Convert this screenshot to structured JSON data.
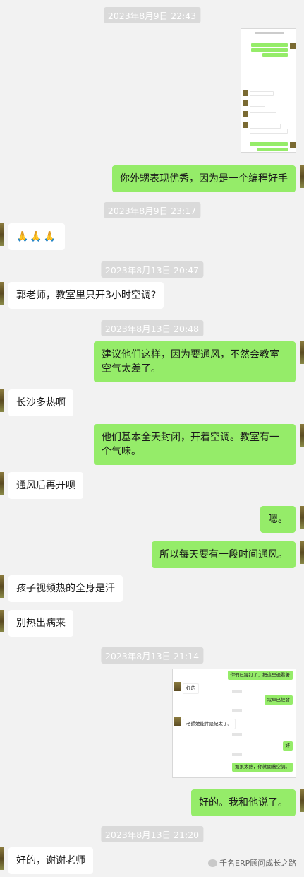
{
  "chat": {
    "timestamps": [
      "2023年8月9日 22:43",
      "2023年8月9日 23:17",
      "2023年8月13日 20:47",
      "2023年8月13日 20:48",
      "2023年8月13日 21:14",
      "2023年8月13日 21:20"
    ],
    "messages": [
      {
        "side": "out",
        "text": "你外甥表现优秀，因为是一个编程好手"
      },
      {
        "side": "in",
        "text": "🙏🙏🙏"
      },
      {
        "side": "in",
        "text": "郭老师，教室里只开3小时空调?"
      },
      {
        "side": "out",
        "text": "建议他们这样，因为要通风，不然会教室空气太差了。"
      },
      {
        "side": "in",
        "text": "长沙多热啊"
      },
      {
        "side": "out",
        "text": "他们基本全天封闭，开着空调。教室有一个气味。"
      },
      {
        "side": "in",
        "text": "通风后再开呗"
      },
      {
        "side": "out",
        "text": "嗯。"
      },
      {
        "side": "out",
        "text": "所以每天要有一段时间通风。"
      },
      {
        "side": "in",
        "text": "孩子视频热的全身是汗"
      },
      {
        "side": "in",
        "text": "别热出病来"
      },
      {
        "side": "out",
        "text": "好的。我和他说了。"
      },
      {
        "side": "in",
        "text": "好的，谢谢老师"
      }
    ],
    "screenshot2": {
      "lines": [
        "你們已經打了，把這里邊看著",
        "好的",
        "電車已經發",
        "老師她能件是紀太了。",
        "好",
        "如果太熱，你就開著空調。"
      ]
    }
  },
  "watermark": "千名ERP顾问成长之路",
  "colors": {
    "background": "#f2f2f2",
    "bubble_out": "#95ec69",
    "bubble_in": "#ffffff",
    "timestamp_bg": "#dadada"
  }
}
